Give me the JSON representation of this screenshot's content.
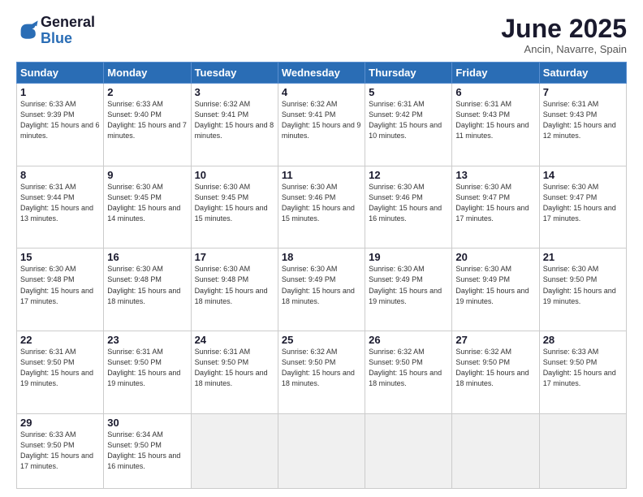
{
  "header": {
    "logo_text_general": "General",
    "logo_text_blue": "Blue",
    "main_title": "June 2025",
    "subtitle": "Ancin, Navarre, Spain"
  },
  "calendar": {
    "days_of_week": [
      "Sunday",
      "Monday",
      "Tuesday",
      "Wednesday",
      "Thursday",
      "Friday",
      "Saturday"
    ],
    "weeks": [
      [
        {
          "day": "1",
          "sunrise": "6:33 AM",
          "sunset": "9:39 PM",
          "daylight": "15 hours and 6 minutes."
        },
        {
          "day": "2",
          "sunrise": "6:33 AM",
          "sunset": "9:40 PM",
          "daylight": "15 hours and 7 minutes."
        },
        {
          "day": "3",
          "sunrise": "6:32 AM",
          "sunset": "9:41 PM",
          "daylight": "15 hours and 8 minutes."
        },
        {
          "day": "4",
          "sunrise": "6:32 AM",
          "sunset": "9:41 PM",
          "daylight": "15 hours and 9 minutes."
        },
        {
          "day": "5",
          "sunrise": "6:31 AM",
          "sunset": "9:42 PM",
          "daylight": "15 hours and 10 minutes."
        },
        {
          "day": "6",
          "sunrise": "6:31 AM",
          "sunset": "9:43 PM",
          "daylight": "15 hours and 11 minutes."
        },
        {
          "day": "7",
          "sunrise": "6:31 AM",
          "sunset": "9:43 PM",
          "daylight": "15 hours and 12 minutes."
        }
      ],
      [
        {
          "day": "8",
          "sunrise": "6:31 AM",
          "sunset": "9:44 PM",
          "daylight": "15 hours and 13 minutes."
        },
        {
          "day": "9",
          "sunrise": "6:30 AM",
          "sunset": "9:45 PM",
          "daylight": "15 hours and 14 minutes."
        },
        {
          "day": "10",
          "sunrise": "6:30 AM",
          "sunset": "9:45 PM",
          "daylight": "15 hours and 15 minutes."
        },
        {
          "day": "11",
          "sunrise": "6:30 AM",
          "sunset": "9:46 PM",
          "daylight": "15 hours and 15 minutes."
        },
        {
          "day": "12",
          "sunrise": "6:30 AM",
          "sunset": "9:46 PM",
          "daylight": "15 hours and 16 minutes."
        },
        {
          "day": "13",
          "sunrise": "6:30 AM",
          "sunset": "9:47 PM",
          "daylight": "15 hours and 17 minutes."
        },
        {
          "day": "14",
          "sunrise": "6:30 AM",
          "sunset": "9:47 PM",
          "daylight": "15 hours and 17 minutes."
        }
      ],
      [
        {
          "day": "15",
          "sunrise": "6:30 AM",
          "sunset": "9:48 PM",
          "daylight": "15 hours and 17 minutes."
        },
        {
          "day": "16",
          "sunrise": "6:30 AM",
          "sunset": "9:48 PM",
          "daylight": "15 hours and 18 minutes."
        },
        {
          "day": "17",
          "sunrise": "6:30 AM",
          "sunset": "9:48 PM",
          "daylight": "15 hours and 18 minutes."
        },
        {
          "day": "18",
          "sunrise": "6:30 AM",
          "sunset": "9:49 PM",
          "daylight": "15 hours and 18 minutes."
        },
        {
          "day": "19",
          "sunrise": "6:30 AM",
          "sunset": "9:49 PM",
          "daylight": "15 hours and 19 minutes."
        },
        {
          "day": "20",
          "sunrise": "6:30 AM",
          "sunset": "9:49 PM",
          "daylight": "15 hours and 19 minutes."
        },
        {
          "day": "21",
          "sunrise": "6:30 AM",
          "sunset": "9:50 PM",
          "daylight": "15 hours and 19 minutes."
        }
      ],
      [
        {
          "day": "22",
          "sunrise": "6:31 AM",
          "sunset": "9:50 PM",
          "daylight": "15 hours and 19 minutes."
        },
        {
          "day": "23",
          "sunrise": "6:31 AM",
          "sunset": "9:50 PM",
          "daylight": "15 hours and 19 minutes."
        },
        {
          "day": "24",
          "sunrise": "6:31 AM",
          "sunset": "9:50 PM",
          "daylight": "15 hours and 18 minutes."
        },
        {
          "day": "25",
          "sunrise": "6:32 AM",
          "sunset": "9:50 PM",
          "daylight": "15 hours and 18 minutes."
        },
        {
          "day": "26",
          "sunrise": "6:32 AM",
          "sunset": "9:50 PM",
          "daylight": "15 hours and 18 minutes."
        },
        {
          "day": "27",
          "sunrise": "6:32 AM",
          "sunset": "9:50 PM",
          "daylight": "15 hours and 18 minutes."
        },
        {
          "day": "28",
          "sunrise": "6:33 AM",
          "sunset": "9:50 PM",
          "daylight": "15 hours and 17 minutes."
        }
      ],
      [
        {
          "day": "29",
          "sunrise": "6:33 AM",
          "sunset": "9:50 PM",
          "daylight": "15 hours and 17 minutes."
        },
        {
          "day": "30",
          "sunrise": "6:34 AM",
          "sunset": "9:50 PM",
          "daylight": "15 hours and 16 minutes."
        },
        null,
        null,
        null,
        null,
        null
      ]
    ]
  }
}
